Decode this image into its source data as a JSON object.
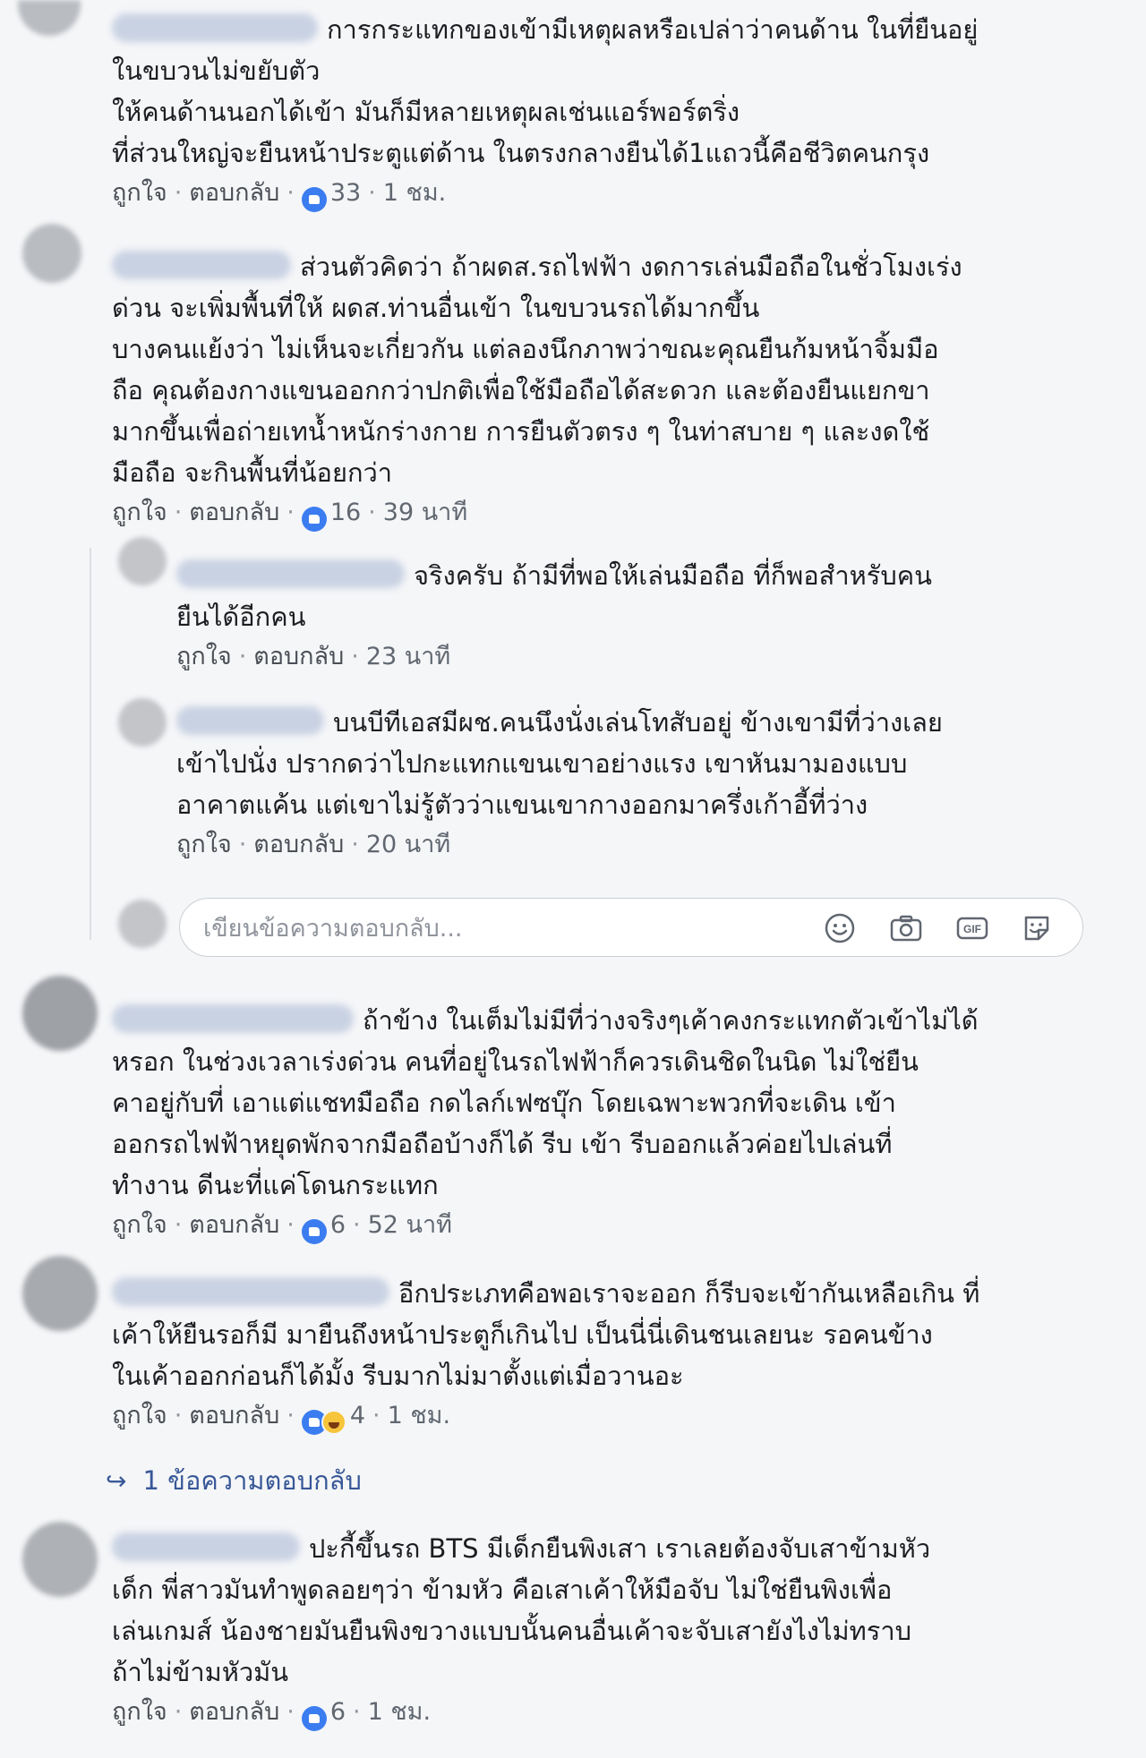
{
  "labels": {
    "like": "ถูกใจ",
    "reply": "ตอบกลับ",
    "separator": "·"
  },
  "comments": [
    {
      "lines": [
        "การกระแทกของเข้ามีเหตุผลหรือเปล่าว่าคนด้าน ในที่ยืนอยู่",
        "ในขบวนไม่ขยับตัว",
        "ให้คนด้านนอกได้เข้า มันก็มีหลายเหตุผลเช่นแอร์พอร์ตริ่ง",
        "ที่ส่วนใหญ่จะยืนหน้าประตูแต่ด้าน ในตรงกลางยืนได้1แถวนี้คือชีวิตคนกรุง"
      ],
      "reactions": "33",
      "reaction_icons": [
        "like-icon"
      ],
      "time": "1 ชม."
    },
    {
      "lines": [
        "ส่วนตัวคิดว่า ถ้าผดส.รถไฟฟ้า งดการเล่นมือถือในชั่วโมงเร่ง",
        "ด่วน จะเพิ่มพื้นที่ให้ ผดส.ท่านอื่นเข้า ในขบวนรถได้มากขึ้น",
        "บางคนแย้งว่า ไม่เห็นจะเกี่ยวกัน แต่ลองนึกภาพว่าขณะคุณยืนก้มหน้าจิ้มมือ",
        "ถือ คุณต้องกางแขนออกกว่าปกติเพื่อใช้มือถือได้สะดวก และต้องยืนแยกขา",
        "มากขึ้นเพื่อถ่ายเทน้ำหนักร่างกาย การยืนตัวตรง ๆ ในท่าสบาย ๆ และงดใช้",
        "มือถือ จะกินพื้นที่น้อยกว่า"
      ],
      "reactions": "16",
      "reaction_icons": [
        "like-icon"
      ],
      "time": "39 นาที"
    },
    {
      "lines": [
        "จริงครับ ถ้ามีที่พอให้เล่นมือถือ ที่ก็พอสำหรับคน",
        "ยืนได้อีกคน"
      ],
      "reactions": "",
      "time": "23 นาที"
    },
    {
      "lines": [
        "บนบีทีเอสมีผช.คนนึงนั่งเล่นโทสับอยู่ ข้างเขามีที่ว่างเลย",
        "เข้าไปนั่ง ปรากดว่าไปกะแทกแขนเขาอย่างแรง เขาหันมามองแบบ",
        "อาคาตแค้น แต่เขาไม่รู้ตัวว่าแขนเขากางออกมาครึ่งเก้าอี้ที่ว่าง"
      ],
      "reactions": "",
      "time": "20 นาที"
    },
    {
      "lines": [
        "ถ้าข้าง ในเต็มไม่มีที่ว่างจริงๆเค้าคงกระแทกตัวเข้าไม่ได้",
        "หรอก ในช่วงเวลาเร่งด่วน คนที่อยู่ในรถไฟฟ้าก็ควรเดินชิดในนิด ไม่ใช่ยืน",
        "คาอยู่กับที่ เอาแต่แชทมือถือ กดไลก์เฟซบุ๊ก โดยเฉพาะพวกที่จะเดิน เข้า",
        "ออกรถไฟฟ้าหยุดพักจากมือถือบ้างก็ได้ รีบ เข้า รีบออกแล้วค่อยไปเล่นที่",
        "ทำงาน ดีนะที่แค่โดนกระแทก"
      ],
      "reactions": "6",
      "reaction_icons": [
        "like-icon"
      ],
      "time": "52 นาที"
    },
    {
      "lines": [
        "อีกประเภทคือพอเราจะออก ก็รีบจะเข้ากันเหลือเกิน ที่",
        "เค้าให้ยืนรอก็มี มายืนถึงหน้าประตูก็เกินไป เป็นนี่นี่เดินชนเลยนะ รอคนข้าง",
        "ในเค้าออกก่อนก็ได้มั้ง รีบมากไม่มาตั้งแต่เมื่อวานอะ"
      ],
      "reactions": "4",
      "reaction_icons": [
        "like-icon",
        "haha-icon"
      ],
      "time": "1 ชม."
    },
    {
      "lines": [
        "ปะกี้ขึ้นรถ BTS มีเด็กยืนพิงเสา เราเลยต้องจับเสาข้ามหัว",
        "เด็ก พี่สาวมันทำพูดลอยๆว่า ข้ามหัว คือเสาเค้าให้มือจับ ไม่ใช่ยืนพิงเพื่อ",
        "เล่นเกมส์ น้องชายมันยืนพิงขวางแบบนั้นคนอื่นเค้าจะจับเสายังไงไม่ทราบ",
        "ถ้าไม่ข้ามหัวมัน"
      ],
      "reactions": "6",
      "reaction_icons": [
        "like-icon"
      ],
      "time": "1 ชม."
    }
  ],
  "reply_box": {
    "placeholder": "เขียนข้อความตอบกลับ...",
    "icons": [
      "emoji-icon",
      "camera-icon",
      "gif-icon",
      "sticker-icon"
    ]
  },
  "more_replies": {
    "text": "1 ข้อความตอบกลับ"
  }
}
